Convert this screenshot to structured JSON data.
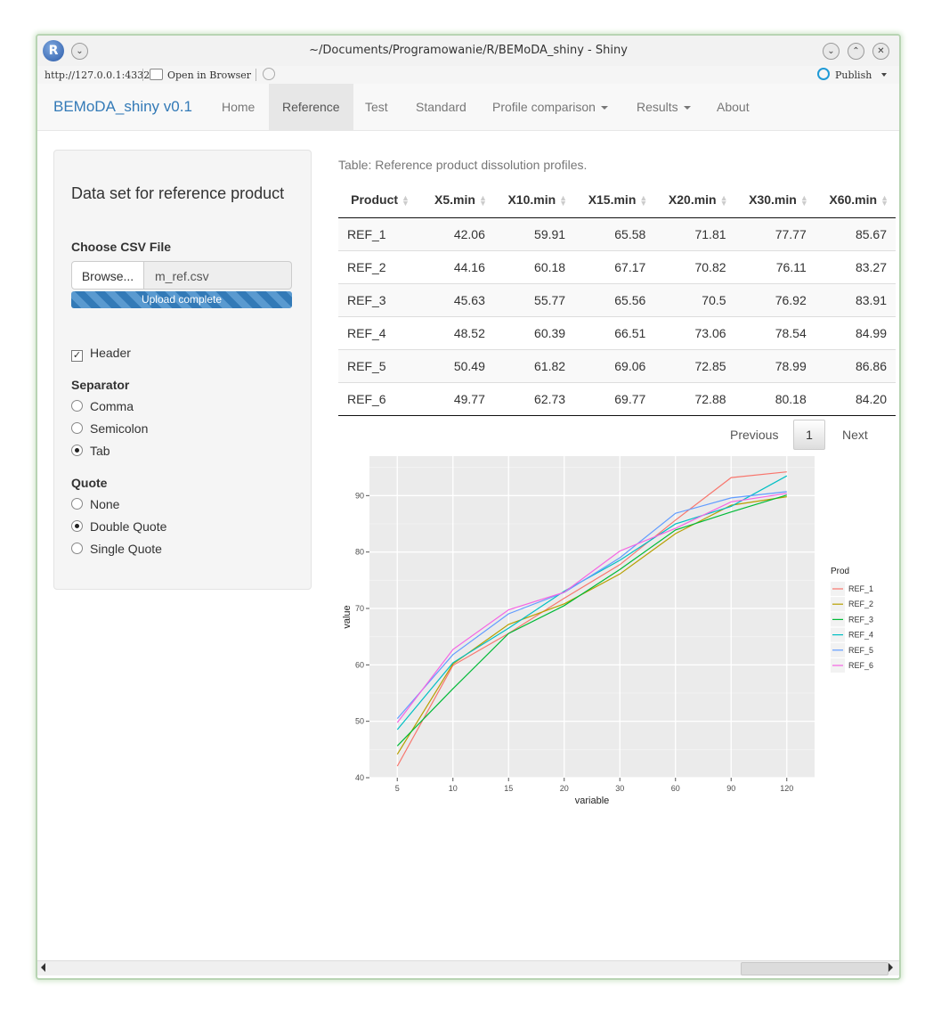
{
  "window": {
    "title": "~/Documents/Programowanie/R/BEMoDA_shiny - Shiny",
    "url": "http://127.0.0.1:4332",
    "open_in_browser": "Open in Browser",
    "publish": "Publish",
    "r_logo": "R"
  },
  "navbar": {
    "brand": "BEMoDA_shiny v0.1",
    "items": [
      {
        "label": "Home"
      },
      {
        "label": "Reference"
      },
      {
        "label": "Test"
      },
      {
        "label": "Standard"
      },
      {
        "label": "Profile comparison"
      },
      {
        "label": "Results"
      },
      {
        "label": "About"
      }
    ],
    "active": "Reference"
  },
  "sidebar": {
    "title": "Data set for reference product",
    "file_label": "Choose CSV File",
    "browse_label": "Browse...",
    "file_name": "m_ref.csv",
    "upload_status": "Upload complete",
    "upload_progress": 1.0,
    "header_label": "Header",
    "header_checked": true,
    "separator_label": "Separator",
    "separator_options": [
      "Comma",
      "Semicolon",
      "Tab"
    ],
    "separator_selected": "Tab",
    "quote_label": "Quote",
    "quote_options": [
      "None",
      "Double Quote",
      "Single Quote"
    ],
    "quote_selected": "Double Quote"
  },
  "main": {
    "caption": "Table: Reference product dissolution profiles.",
    "columns": [
      "Product",
      "X5.min",
      "X10.min",
      "X15.min",
      "X20.min",
      "X30.min",
      "X60.min"
    ],
    "rows": [
      [
        "REF_1",
        "42.06",
        "59.91",
        "65.58",
        "71.81",
        "77.77",
        "85.67"
      ],
      [
        "REF_2",
        "44.16",
        "60.18",
        "67.17",
        "70.82",
        "76.11",
        "83.27"
      ],
      [
        "REF_3",
        "45.63",
        "55.77",
        "65.56",
        "70.5",
        "76.92",
        "83.91"
      ],
      [
        "REF_4",
        "48.52",
        "60.39",
        "66.51",
        "73.06",
        "78.54",
        "84.99"
      ],
      [
        "REF_5",
        "50.49",
        "61.82",
        "69.06",
        "72.85",
        "78.99",
        "86.86"
      ],
      [
        "REF_6",
        "49.77",
        "62.73",
        "69.77",
        "72.88",
        "80.18",
        "84.20"
      ]
    ],
    "pager": {
      "previous": "Previous",
      "current": "1",
      "next": "Next"
    }
  },
  "chart_data": {
    "type": "line",
    "title": "",
    "xlabel": "variable",
    "ylabel": "value",
    "categories": [
      "5",
      "10",
      "15",
      "20",
      "30",
      "60",
      "90",
      "120"
    ],
    "ylim": [
      40,
      97
    ],
    "yticks": [
      40,
      50,
      60,
      70,
      80,
      90
    ],
    "grid": true,
    "legend_title": "Prod",
    "legend_position": "right",
    "series": [
      {
        "name": "REF_1",
        "color": "#F8766D",
        "values": [
          42.06,
          59.91,
          65.58,
          71.81,
          77.77,
          85.67,
          93.2,
          94.2
        ]
      },
      {
        "name": "REF_2",
        "color": "#B79F00",
        "values": [
          44.16,
          60.18,
          67.17,
          70.82,
          76.11,
          83.27,
          88.3,
          89.8
        ]
      },
      {
        "name": "REF_3",
        "color": "#00BA38",
        "values": [
          45.63,
          55.77,
          65.56,
          70.5,
          76.92,
          83.91,
          87.1,
          90.1
        ]
      },
      {
        "name": "REF_4",
        "color": "#00BFC4",
        "values": [
          48.52,
          60.39,
          66.51,
          73.06,
          78.54,
          84.99,
          88.1,
          93.5
        ]
      },
      {
        "name": "REF_5",
        "color": "#619CFF",
        "values": [
          50.49,
          61.82,
          69.06,
          72.85,
          78.99,
          86.86,
          89.6,
          90.7
        ]
      },
      {
        "name": "REF_6",
        "color": "#F564E3",
        "values": [
          49.77,
          62.73,
          69.77,
          72.88,
          80.18,
          84.2,
          88.9,
          90.4
        ]
      }
    ]
  }
}
